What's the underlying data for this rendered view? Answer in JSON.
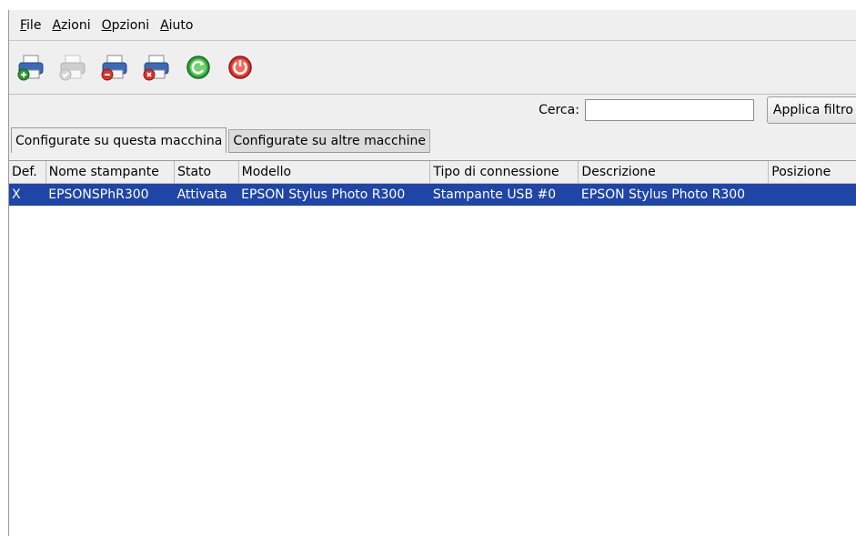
{
  "menubar": {
    "items": [
      {
        "accel": "F",
        "rest": "ile"
      },
      {
        "accel": "A",
        "rest": "zioni"
      },
      {
        "accel": "O",
        "rest": "pzioni"
      },
      {
        "accel": "A",
        "rest": "iuto"
      }
    ]
  },
  "toolbar": {
    "buttons": [
      {
        "icon": "printer-add-icon"
      },
      {
        "icon": "printer-disabled-icon"
      },
      {
        "icon": "printer-remove-icon"
      },
      {
        "icon": "printer-properties-icon"
      },
      {
        "icon": "refresh-green-icon"
      },
      {
        "icon": "power-red-icon"
      }
    ]
  },
  "search": {
    "label": "Cerca:",
    "value": "",
    "filter_button": "Applica filtro"
  },
  "tabs": [
    {
      "label": "Configurate su questa macchina",
      "active": true
    },
    {
      "label": "Configurate su altre macchine",
      "active": false
    }
  ],
  "table": {
    "columns": [
      "Def.",
      "Nome stampante",
      "Stato",
      "Modello",
      "Tipo di connessione",
      "Descrizione",
      "Posizione"
    ],
    "rows": [
      [
        "X",
        "EPSONSPhR300",
        "Attivata",
        "EPSON Stylus Photo R300",
        "Stampante USB #0",
        "EPSON Stylus Photo R300",
        ""
      ]
    ]
  },
  "colors": {
    "selection": "#1f45a7",
    "window_bg": "#efefef"
  }
}
